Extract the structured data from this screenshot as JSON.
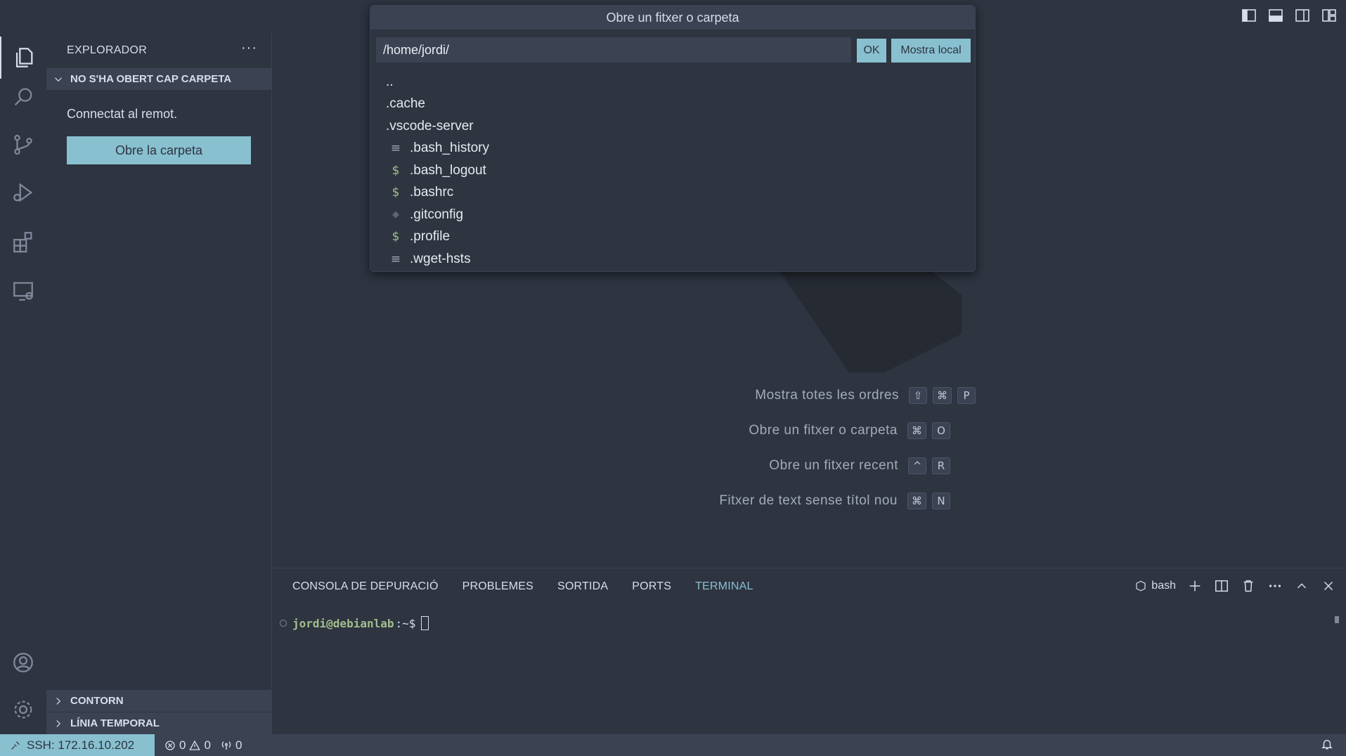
{
  "quickpick": {
    "title": "Obre un fitxer o carpeta",
    "input_value": "/home/jordi/",
    "ok_label": "OK",
    "show_local_label": "Mostra local",
    "items": [
      {
        "label": "..",
        "icon": "none"
      },
      {
        "label": ".cache",
        "icon": "none"
      },
      {
        "label": ".vscode-server",
        "icon": "none"
      },
      {
        "label": ".bash_history",
        "icon": "lines-icon"
      },
      {
        "label": ".bash_logout",
        "icon": "dollar-icon"
      },
      {
        "label": ".bashrc",
        "icon": "dollar-icon"
      },
      {
        "label": ".gitconfig",
        "icon": "diamond-icon"
      },
      {
        "label": ".profile",
        "icon": "dollar-icon"
      },
      {
        "label": ".wget-hsts",
        "icon": "lines-icon"
      }
    ]
  },
  "sidebar": {
    "title": "EXPLORADOR",
    "more": "···",
    "section_folder": "NO S'HA OBERT CAP CARPETA",
    "connected_text": "Connectat al remot.",
    "open_folder_label": "Obre la carpeta",
    "section_outline": "CONTORN",
    "section_timeline": "LÍNIA TEMPORAL"
  },
  "shortcuts": [
    {
      "label": "Mostra totes les ordres",
      "keys": [
        "⇧",
        "⌘",
        "P"
      ]
    },
    {
      "label": "Obre un fitxer o carpeta",
      "keys": [
        "⌘",
        "O"
      ]
    },
    {
      "label": "Obre un fitxer recent",
      "keys": [
        "^",
        "R"
      ]
    },
    {
      "label": "Fitxer de text sense títol nou",
      "keys": [
        "⌘",
        "N"
      ]
    }
  ],
  "panel": {
    "tabs": [
      "CONSOLA DE DEPURACIÓ",
      "PROBLEMES",
      "SORTIDA",
      "PORTS",
      "TERMINAL"
    ],
    "active_tab": "TERMINAL",
    "shell_label": "bash",
    "prompt_user": "jordi@debianlab",
    "prompt_rest": ":~$"
  },
  "statusbar": {
    "remote": "SSH: 172.16.10.202",
    "errors": "0",
    "warnings": "0",
    "ports": "0"
  },
  "colors": {
    "background": "#2e3440",
    "surface": "#3b4252",
    "accent": "#88c0d0",
    "green": "#a3be8c",
    "text": "#d8dee9"
  }
}
